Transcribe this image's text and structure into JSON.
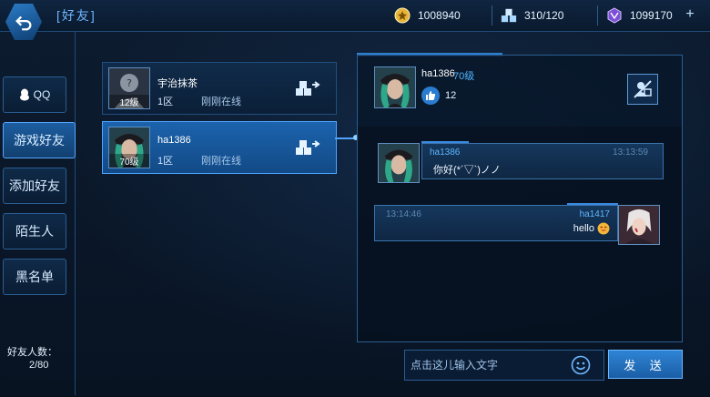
{
  "header": {
    "title": "[好友]",
    "coins": "1008940",
    "inventory": "310/120",
    "gems": "1099170",
    "plus": "+"
  },
  "tabs": [
    {
      "label": "QQ"
    },
    {
      "label": "游戏好友"
    },
    {
      "label": "添加好友"
    },
    {
      "label": "陌生人"
    },
    {
      "label": "黑名单"
    }
  ],
  "friend_count": {
    "label": "好友人数：",
    "value": "2/80"
  },
  "friends": [
    {
      "name": "宇治抹茶",
      "level": "12级",
      "zone": "1区",
      "status": "刚刚在线"
    },
    {
      "name": "ha1386",
      "level": "70级",
      "zone": "1区",
      "status": "刚刚在线"
    }
  ],
  "chat": {
    "name": "ha1386",
    "level": "70级",
    "likes": "12",
    "messages": [
      {
        "author": "ha1386",
        "time": "13:13:59",
        "text": "你好(*´▽`)ノノ"
      },
      {
        "author": "ha1417",
        "time": "13:14:46",
        "text": "hello"
      }
    ]
  },
  "input": {
    "placeholder": "点击这儿输入文字"
  },
  "send_label": "发 送",
  "colors": {
    "accent": "#4fa3ff",
    "panel": "#0b1f37",
    "selected": "#1c63ad"
  }
}
